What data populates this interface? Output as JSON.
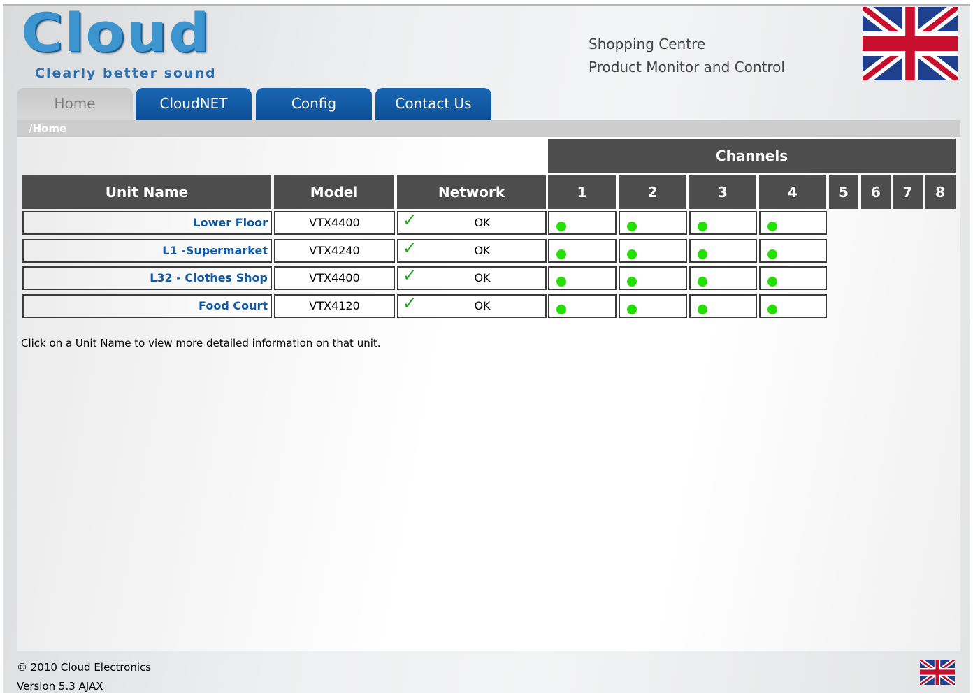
{
  "header": {
    "logo_word": "Cloud",
    "logo_tagline": "Clearly better sound",
    "site_title_line1": "Shopping Centre",
    "site_title_line2": "Product Monitor and Control",
    "flag_icon": "uk-flag-icon"
  },
  "tabs": [
    {
      "label": "Home",
      "active": true
    },
    {
      "label": "CloudNET",
      "active": false
    },
    {
      "label": "Config",
      "active": false
    },
    {
      "label": "Contact Us",
      "active": false
    }
  ],
  "breadcrumb": "/Home",
  "table": {
    "group_header": "Channels",
    "columns": {
      "unit_name": "Unit Name",
      "model": "Model",
      "network": "Network",
      "channels": [
        "1",
        "2",
        "3",
        "4",
        "5",
        "6",
        "7",
        "8"
      ]
    },
    "rows": [
      {
        "unit_name": "Lower Floor",
        "model": "VTX4400",
        "network": "OK"
      },
      {
        "unit_name": "L1 -Supermarket",
        "model": "VTX4240",
        "network": "OK"
      },
      {
        "unit_name": "L32 - Clothes Shop",
        "model": "VTX4400",
        "network": "OK"
      },
      {
        "unit_name": "Food Court",
        "model": "VTX4120",
        "network": "OK"
      }
    ],
    "status_color": "#22e000"
  },
  "note": "Click on a Unit Name to view more detailed information on that unit.",
  "footer": {
    "copyright": "© 2010 Cloud Electronics",
    "version": "Version 5.3 AJAX"
  },
  "colors": {
    "tab_blue": "#0c4f97",
    "header_dark": "#4d4d4d",
    "link": "#0f5aa6"
  }
}
